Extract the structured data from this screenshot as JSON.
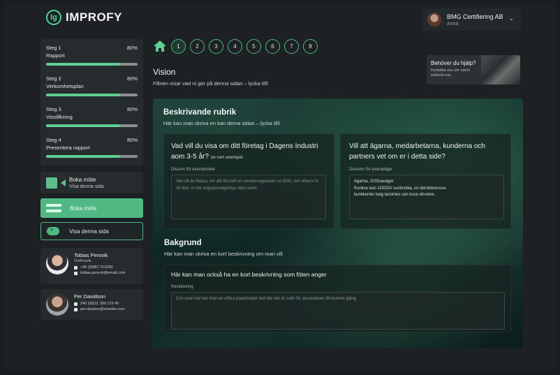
{
  "brand": {
    "name": "IMPROFY"
  },
  "account": {
    "company": "BMG Certifiering AB",
    "user": "Anna"
  },
  "steps": [
    {
      "label": "Steg 1",
      "name": "Rapport",
      "percent": "80%",
      "progress": 0.8
    },
    {
      "label": "Steg 2",
      "name": "Verkomhetsplan",
      "percent": "80%",
      "progress": 0.8
    },
    {
      "label": "Steg 3",
      "name": "Visolifkning",
      "percent": "80%",
      "progress": 0.8
    },
    {
      "label": "Steg 4",
      "name": "Presentera rapport",
      "percent": "80%",
      "progress": 0.8
    }
  ],
  "booking_card": {
    "title": "Boka möte",
    "subtitle": "Visa denna sida"
  },
  "book_button": "Boka möte",
  "view_button": "Visa denna sida",
  "contacts": [
    {
      "name": "Tobias Persvik",
      "role": "Ordförade",
      "phone": "+46 (0)887 213330",
      "email": "tobias.persvik@email.com"
    },
    {
      "name": "Per Davidson",
      "role": "",
      "phone": "246 (0)011 399 123 45",
      "email": "per.davison@emaibe.com"
    }
  ],
  "nav": {
    "steps": [
      "1",
      "2",
      "3",
      "4",
      "5",
      "6",
      "7",
      "8"
    ],
    "active": "1"
  },
  "help": {
    "title": "Behöver du hjälp?",
    "text": "Kontakta oss vor osem sekkinb oss."
  },
  "page": {
    "title": "Vision",
    "subtitle": "Fillnen visar vad ni gör på denna sidan – lycka till!"
  },
  "section1": {
    "title": "Beskrivande rubrik",
    "subtitle": "Här kan man skriva en kan derna sidan – lycka till!",
    "q1": {
      "question": "Vad vill du visa om ditt företag i Dagens Industri aom 3-5 år?",
      "example_link": "se vort exempel",
      "field_label": "Dissom för exemptiober",
      "placeholder": "Viel vill du fieoca, om ditt förcash es conderongetsaen vo.50%, och oltvers fo olt ölss, in her exgeaconngeroys sidia soml!"
    },
    "q2": {
      "question": "Vill att ägarna, medarbetarna, kunderna och partners vet om er i detta side?",
      "field_label": "Dessom för exemptiger",
      "value_line1": "Agarna, 10Glsavager",
      "value_line2": "Kunkce ean 1ODOU sustinsika, un dersbiesinsva",
      "value_line3": "kunkkenter kaig lanomes can kuse ehveine."
    }
  },
  "section2": {
    "title": "Bakgrund",
    "subtitle": "Här kan man skriva en kort beskrivning om man vill",
    "question": "Här kan man också ha en kort beskrivning som föten anger",
    "field_label": "Reskieering",
    "placeholder": "Cch exen här kar man en utföra placeholder text där det är svårt för anvandaren dit komme igång"
  },
  "colors": {
    "accent": "#5fce94",
    "button": "#4fb883",
    "background": "#1d2124"
  }
}
